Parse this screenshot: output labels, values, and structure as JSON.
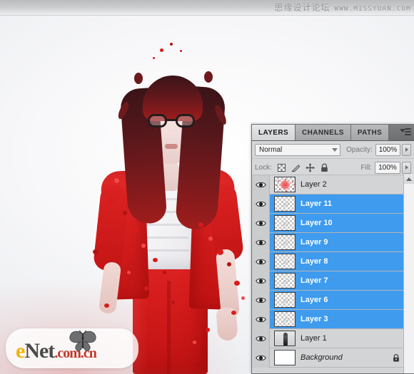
{
  "watermark": {
    "chinese": "思缘设计论坛",
    "url": "WWW.MISSYUAN.COM"
  },
  "logo": {
    "part_e": "e",
    "part_net": "Net",
    "part_domain_com": ".com",
    "part_domain_cn": ".cn",
    "icon": "butterfly-icon"
  },
  "panel": {
    "tabs": [
      {
        "label": "LAYERS",
        "active": true
      },
      {
        "label": "CHANNELS",
        "active": false
      },
      {
        "label": "PATHS",
        "active": false
      }
    ],
    "menu_icon": "panel-menu-icon",
    "blend_mode": "Normal",
    "opacity_label": "Opacity:",
    "opacity_value": "100%",
    "fill_label": "Fill:",
    "fill_value": "100%",
    "lock_label": "Lock:",
    "lock_icons": [
      "lock-transparent-pixels-icon",
      "lock-image-pixels-icon",
      "lock-position-icon",
      "lock-all-icon"
    ],
    "selection_color": "#3e9bee",
    "layers": [
      {
        "name": "Layer 2",
        "selected": false,
        "visible": true,
        "thumb": "splatter",
        "locked": false,
        "italic": false
      },
      {
        "name": "Layer 11",
        "selected": true,
        "visible": true,
        "thumb": "transparent",
        "locked": false,
        "italic": false
      },
      {
        "name": "Layer 10",
        "selected": true,
        "visible": true,
        "thumb": "transparent",
        "locked": false,
        "italic": false
      },
      {
        "name": "Layer 9",
        "selected": true,
        "visible": true,
        "thumb": "transparent",
        "locked": false,
        "italic": false
      },
      {
        "name": "Layer 8",
        "selected": true,
        "visible": true,
        "thumb": "transparent",
        "locked": false,
        "italic": false
      },
      {
        "name": "Layer 7",
        "selected": true,
        "visible": true,
        "thumb": "transparent",
        "locked": false,
        "italic": false
      },
      {
        "name": "Layer 6",
        "selected": true,
        "visible": true,
        "thumb": "transparent",
        "locked": false,
        "italic": false
      },
      {
        "name": "Layer 3",
        "selected": true,
        "visible": true,
        "thumb": "transparent",
        "locked": false,
        "italic": false
      },
      {
        "name": "Layer 1",
        "selected": false,
        "visible": true,
        "thumb": "photo",
        "locked": false,
        "italic": false
      },
      {
        "name": "Background",
        "selected": false,
        "visible": true,
        "thumb": "white",
        "locked": true,
        "italic": true
      }
    ]
  }
}
